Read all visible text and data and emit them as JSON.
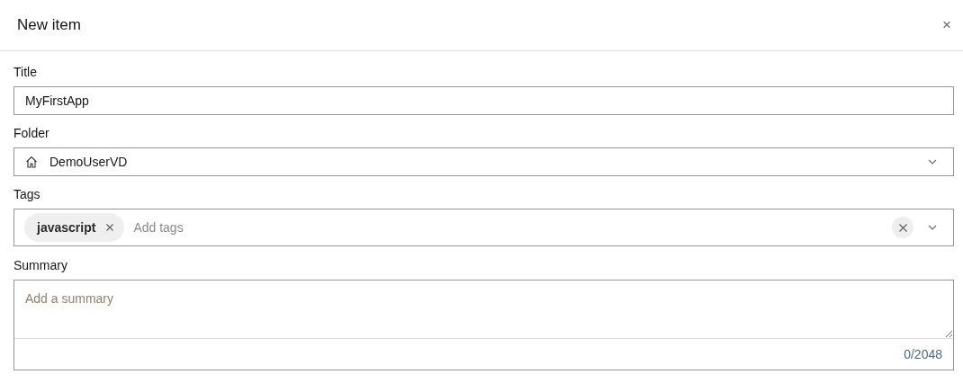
{
  "dialog": {
    "title": "New item",
    "close_label": "×"
  },
  "fields": [
    {
      "kind": "text",
      "label": "Title",
      "value": "MyFirstApp"
    },
    {
      "kind": "select",
      "label": "Folder",
      "value": "DemoUserVD"
    },
    {
      "kind": "tags",
      "label": "Tags",
      "tags": [
        "javascript"
      ],
      "placeholder": "Add tags"
    },
    {
      "kind": "textarea",
      "label": "Summary",
      "placeholder": "Add a summary",
      "counter": "0/2048"
    }
  ]
}
